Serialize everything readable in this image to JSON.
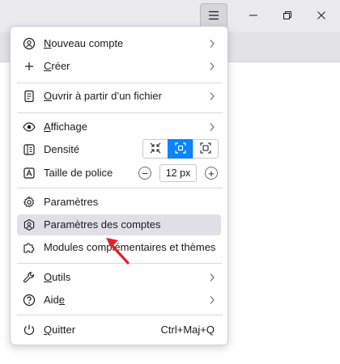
{
  "window": {
    "menu_icon": "hamburger-icon",
    "minimize_icon": "minimize-icon",
    "maximize_icon": "restore-icon",
    "close_icon": "close-icon"
  },
  "menu": {
    "new_account": {
      "accel": "N",
      "rest": "ouveau compte",
      "icon": "account-icon"
    },
    "create": {
      "accel": "C",
      "rest": "réer",
      "icon": "plus-icon"
    },
    "open_file": {
      "accel": "O",
      "rest": "uvrir à partir d’un fichier",
      "icon": "file-icon"
    },
    "view": {
      "accel": "A",
      "rest": "ffichage",
      "icon": "eye-icon"
    },
    "density": {
      "label": "Densité",
      "icon": "density-icon",
      "options": [
        "compact",
        "normal",
        "touch"
      ],
      "selected": "normal"
    },
    "font_size": {
      "label": "Taille de police",
      "value": "12 px",
      "minus": "−",
      "plus": "+",
      "icon": "font-size-icon"
    },
    "settings": {
      "label": "Paramètres",
      "icon": "gear-icon"
    },
    "account_settings": {
      "label": "Paramètres des comptes",
      "icon": "account-settings-icon"
    },
    "addons": {
      "label": "Modules complémentaires et thèmes",
      "icon": "puzzle-icon"
    },
    "tools": {
      "accel": "O",
      "rest": "utils",
      "icon": "wrench-icon"
    },
    "help": {
      "label_before": "Aid",
      "accel": "e",
      "icon": "help-icon"
    },
    "quit": {
      "accel": "Q",
      "rest": "uitter",
      "shortcut": "Ctrl+Maj+Q",
      "icon": "power-icon"
    }
  },
  "colors": {
    "accent": "#0a84ff",
    "hover": "#e0e0e6",
    "arrow": "#e0202a"
  }
}
